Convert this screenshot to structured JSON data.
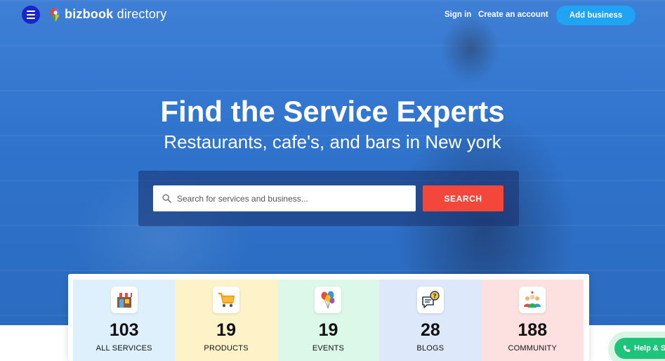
{
  "header": {
    "logo_bold": "bizbook",
    "logo_light": " directory",
    "sign_in": "Sign in",
    "create_account": "Create an account",
    "add_business": "Add business"
  },
  "hero": {
    "title": "Find the Service Experts",
    "subtitle": "Restaurants, cafe's, and bars in New york"
  },
  "search": {
    "placeholder": "Search for services and business...",
    "value": "",
    "button_label": "SEARCH"
  },
  "stats": [
    {
      "count": "103",
      "label": "ALL SERVICES",
      "icon": "shop-icon",
      "bg": "#dff0fd"
    },
    {
      "count": "19",
      "label": "PRODUCTS",
      "icon": "shopping-cart-icon",
      "bg": "#fdf2c8"
    },
    {
      "count": "19",
      "label": "EVENTS",
      "icon": "balloons-icon",
      "bg": "#dcf8e8"
    },
    {
      "count": "28",
      "label": "BLOGS",
      "icon": "chat-bubble-icon",
      "bg": "#dde8fb"
    },
    {
      "count": "188",
      "label": "COMMUNITY",
      "icon": "community-icon",
      "bg": "#fde1e1"
    }
  ],
  "help": {
    "label": "Help & Su"
  },
  "colors": {
    "hero_blue": "#2f73cc",
    "menu_button": "#1a26c9",
    "add_business": "#1ea4f2",
    "search_button": "#f4473b",
    "help_button": "#1ec47a"
  }
}
